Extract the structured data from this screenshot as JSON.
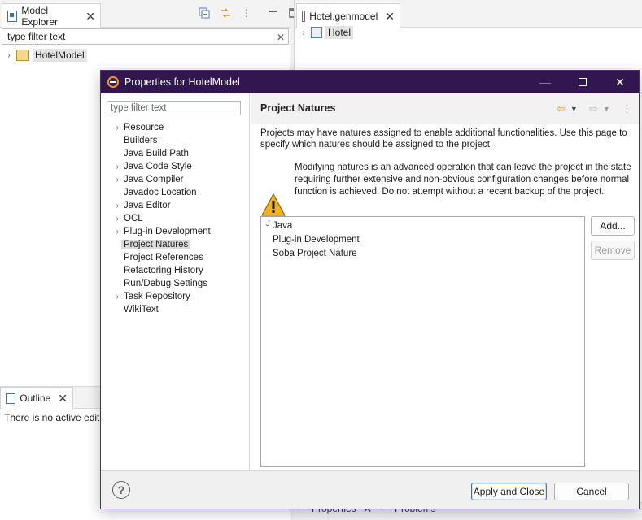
{
  "ide": {
    "model_explorer": {
      "tab_label": "Model Explorer",
      "filter_value": "type filter text",
      "tree_root": "HotelModel"
    },
    "editor": {
      "tab_label": "Hotel.genmodel",
      "tree_root": "Hotel"
    },
    "outline": {
      "tab_label": "Outline",
      "message": "There is no active editor"
    },
    "bottom_tabs": [
      "Properties",
      "Problems"
    ]
  },
  "dialog": {
    "title": "Properties for HotelModel",
    "filter_placeholder": "type filter text",
    "nav_items": [
      {
        "label": "Resource",
        "expandable": true
      },
      {
        "label": "Builders",
        "expandable": false
      },
      {
        "label": "Java Build Path",
        "expandable": false
      },
      {
        "label": "Java Code Style",
        "expandable": true
      },
      {
        "label": "Java Compiler",
        "expandable": true
      },
      {
        "label": "Javadoc Location",
        "expandable": false
      },
      {
        "label": "Java Editor",
        "expandable": true
      },
      {
        "label": "OCL",
        "expandable": true
      },
      {
        "label": "Plug-in Development",
        "expandable": true
      },
      {
        "label": "Project Natures",
        "expandable": false,
        "selected": true
      },
      {
        "label": "Project References",
        "expandable": false
      },
      {
        "label": "Refactoring History",
        "expandable": false
      },
      {
        "label": "Run/Debug Settings",
        "expandable": false
      },
      {
        "label": "Task Repository",
        "expandable": true
      },
      {
        "label": "WikiText",
        "expandable": false
      }
    ],
    "page": {
      "title": "Project Natures",
      "description": "Projects may have natures assigned to enable additional functionalities. Use this page to specify which natures should be assigned to the project.",
      "warning": "Modifying natures is an advanced operation that can leave the project in the state requiring further extensive and non-obvious configuration changes before normal function is achieved. Do not attempt without a recent backup of the project.",
      "natures": [
        "Java",
        "Plug-in Development",
        "Soba Project Nature"
      ],
      "add_label": "Add...",
      "remove_label": "Remove"
    },
    "footer": {
      "apply_close_label": "Apply and Close",
      "cancel_label": "Cancel"
    }
  },
  "colors": {
    "title_bar": "#321650",
    "primary_border": "#3c74c8",
    "warning": "#f2b01e"
  },
  "icons": [
    "view-menu-icon",
    "collapse-all-icon",
    "link-editor-icon",
    "minimize-icon",
    "maximize-icon",
    "close-icon",
    "back-arrow-icon",
    "forward-arrow-icon",
    "help-icon",
    "warning-icon",
    "java-nature-icon",
    "eclipse-icon"
  ]
}
